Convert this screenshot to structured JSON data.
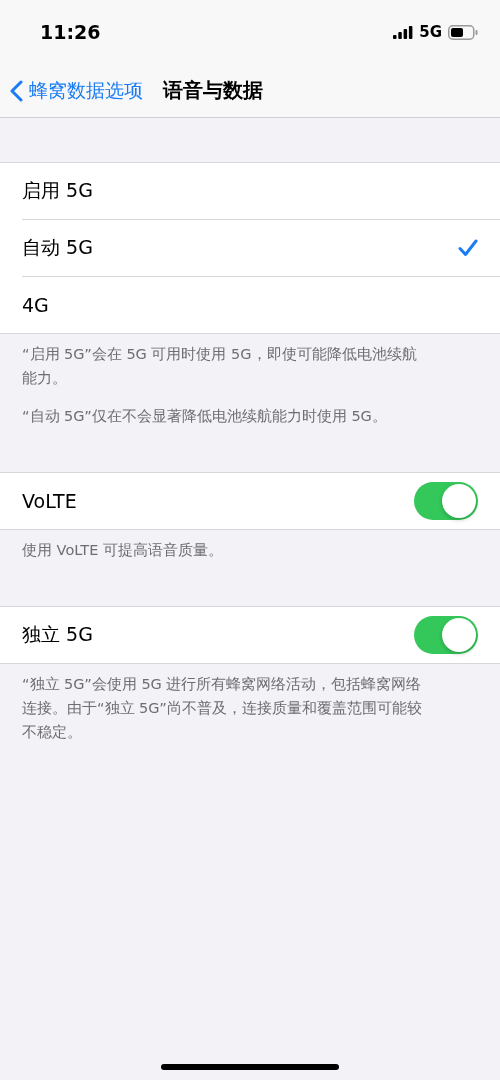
{
  "status_bar": {
    "time": "11:26",
    "network": "5G"
  },
  "nav": {
    "back": "蜂窝数据选项",
    "title": "语音与数据"
  },
  "sections": [
    {
      "rows": [
        {
          "kind": "option",
          "label": "启用 5G",
          "selected": false
        },
        {
          "kind": "option",
          "label": "自动 5G",
          "selected": true
        },
        {
          "kind": "option",
          "label": "4G",
          "selected": false
        }
      ],
      "footer": [
        "“启用 5G”会在 5G 可用时使用 5G，即使可能降低电池续航能力。",
        "“自动 5G”仅在不会显著降低电池续航能力时使用 5G。"
      ]
    },
    {
      "rows": [
        {
          "kind": "toggle",
          "label": "VoLTE",
          "on": true
        }
      ],
      "footer": [
        "使用 VoLTE 可提高语音质量。"
      ]
    },
    {
      "rows": [
        {
          "kind": "toggle",
          "label": "独立 5G",
          "on": true
        }
      ],
      "footer": [
        "“独立 5G”会使用 5G 进行所有蜂窝网络活动，包括蜂窝网络连接。由于“独立 5G”尚不普及，连接质量和覆盖范围可能较不稳定。"
      ]
    }
  ]
}
